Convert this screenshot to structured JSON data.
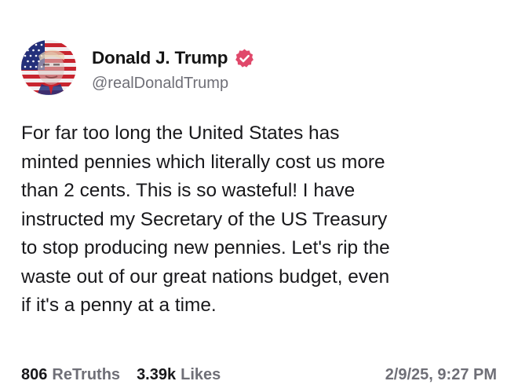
{
  "author": {
    "display_name": "Donald J. Trump",
    "handle": "@realDonaldTrump",
    "verified": true,
    "verified_color": "#e0486a",
    "avatar_icon": "flag-portrait-avatar"
  },
  "post": {
    "text": "For far too long the United States has\nminted pennies which literally cost us more\nthan 2 cents. This is so wasteful! I have\ninstructed my Secretary of the US Treasury\nto stop producing new pennies. Let's rip the\nwaste out of our great nations budget, even\nif it's a penny at a time."
  },
  "stats": {
    "retruths_count": "806",
    "retruths_label": "ReTruths",
    "likes_count": "3.39k",
    "likes_label": "Likes",
    "timestamp": "2/9/25, 9:27 PM"
  },
  "colors": {
    "text_primary": "#18181b",
    "text_secondary": "#6f6f77",
    "background": "#ffffff"
  }
}
